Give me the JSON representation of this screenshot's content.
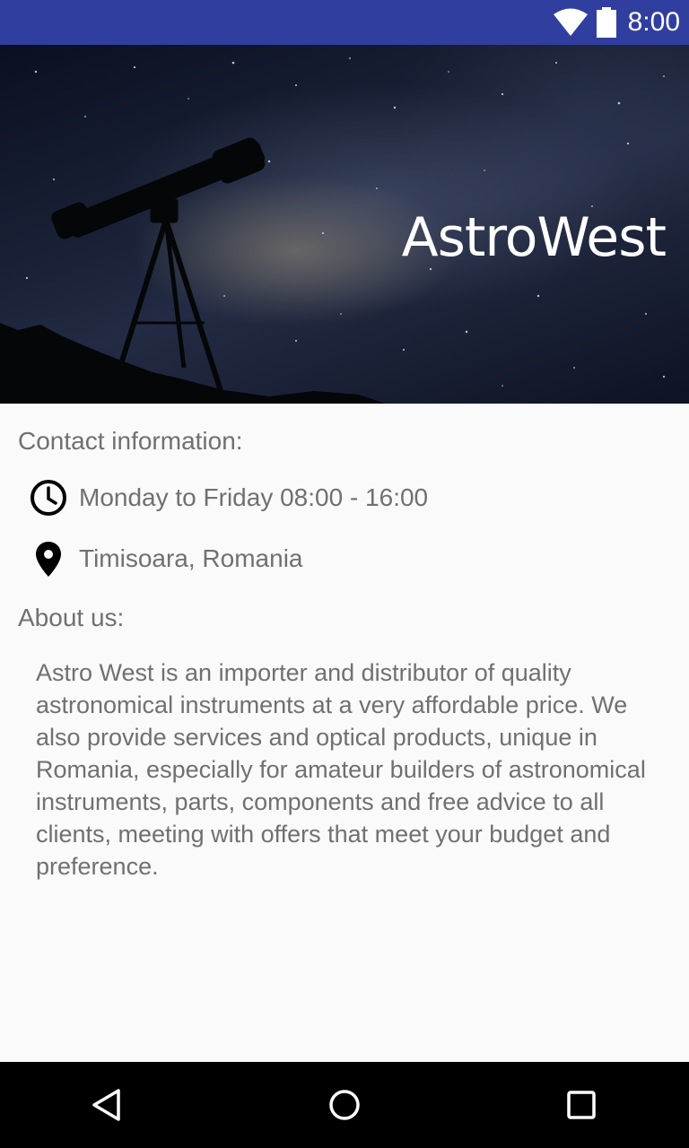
{
  "status_bar": {
    "time": "8:00",
    "icons": [
      "wifi-icon",
      "battery-icon"
    ],
    "background": "#303f9f"
  },
  "header": {
    "title": "AstroWest",
    "image": "telescope silhouette under milky way night sky"
  },
  "contact": {
    "heading": "Contact information:",
    "hours": "Monday to Friday 08:00 - 16:00",
    "hours_icon": "clock-icon",
    "location": "Timisoara, Romania",
    "location_icon": "location-pin-icon"
  },
  "about": {
    "heading": "About us:",
    "text": "Astro West is an importer and distributor of quality astronomical instruments at a very affordable price. We also provide services and optical products, unique in Romania, especially for amateur builders of astronomical instruments, parts, components and free advice to all clients, meeting with offers that meet your budget and preference."
  },
  "nav_bar": {
    "buttons": [
      "back-icon",
      "home-icon",
      "recents-icon"
    ]
  },
  "colors": {
    "text_secondary": "#707070",
    "background": "#fafafa"
  }
}
